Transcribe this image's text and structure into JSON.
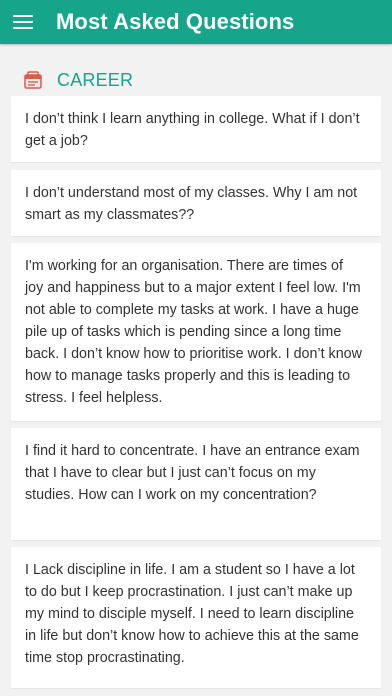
{
  "app_bar": {
    "title": "Most Asked Questions",
    "menu_icon": "hamburger-menu-icon",
    "color": "#16a58a"
  },
  "section": {
    "title": "CAREER",
    "icon": "career-briefcase-icon",
    "accent_color": "#16a58a"
  },
  "questions": [
    {
      "text": "I don’t think I learn anything in college. What if I don’t get a job?"
    },
    {
      "text": "I don’t understand most of my classes. Why I am not smart as my classmates??"
    },
    {
      "text": "I'm working for an organisation. There are times of joy and happiness but to a major extent I feel low. I'm not able to complete my tasks at work. I have a huge pile up of tasks which is pending since a long time back. I don’t know how to prioritise work. I don’t know how to manage tasks properly and this is leading to stress. I feel helpless."
    },
    {
      "text": "I find it hard to concentrate. I have an entrance exam that I have to clear but I just can’t focus on my studies. How can I work on my concentration?"
    },
    {
      "text": "I Lack discipline in life. I am a student so I have a lot to do but I keep procrastination. I just can’t make up my mind to disciple myself. I need to learn discipline in life but don’t know how to achieve this at the same time stop procrastinating."
    }
  ]
}
